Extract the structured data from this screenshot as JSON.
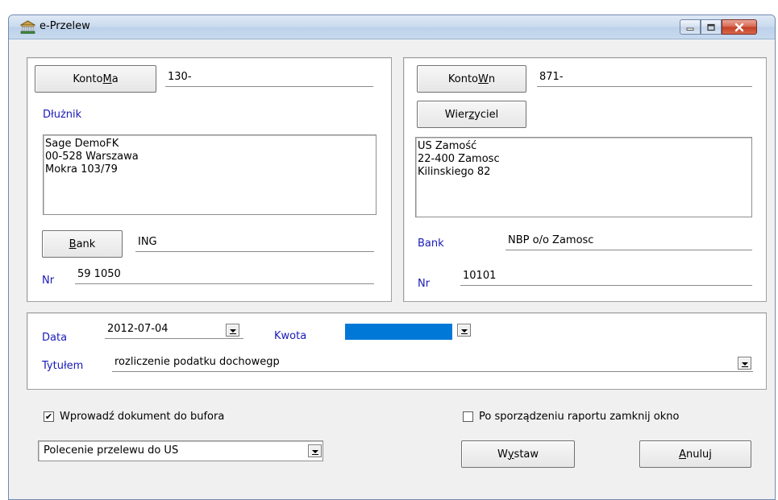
{
  "window": {
    "title": "e-Przelew"
  },
  "left": {
    "konto_button": {
      "prefix": "Konto ",
      "underlined": "M",
      "suffix": "a"
    },
    "konto_value": "130-",
    "dluznik_label": "Dłużnik",
    "address_lines": [
      "Sage DemoFK",
      "00-528 Warszawa",
      "Mokra 103/79"
    ],
    "bank_button": {
      "underlined": "B",
      "suffix": "ank"
    },
    "bank_value": "ING",
    "nr_label": "Nr",
    "nr_value": "59 1050"
  },
  "right": {
    "konto_button": {
      "prefix": "Konto ",
      "underlined": "W",
      "suffix": "n"
    },
    "konto_value": "871-",
    "wierzyciel_button": {
      "prefix": "Wier",
      "underlined": "z",
      "suffix": "yciel"
    },
    "address_lines": [
      "US Zamość",
      "22-400 Zamosc",
      "Kilinskiego 82"
    ],
    "bank_label": "Bank",
    "bank_value": "NBP o/o Zamosc",
    "nr_label": "Nr",
    "nr_value": "10101"
  },
  "middle": {
    "data_label": "Data",
    "data_value": "2012-07-04",
    "kwota_label": "Kwota",
    "kwota_value": "",
    "tytulem_label": "Tytułem",
    "tytulem_value": "rozliczenie podatku dochowegp"
  },
  "bottom": {
    "buffer_checkbox": {
      "label": "Wprowadź dokument do bufora",
      "checked": true
    },
    "close_checkbox": {
      "label": "Po sporządzeniu raportu zamknij okno",
      "checked": false
    },
    "doc_type_select": "Polecenie przelewu do US",
    "wystaw_button": {
      "prefix": "W",
      "underlined": "y",
      "suffix": "staw"
    },
    "anuluj_button": {
      "prefix": "",
      "underlined": "A",
      "suffix": "nuluj"
    }
  },
  "colors": {
    "label_blue": "#1a1ab8",
    "kwota_highlight": "#0078d7"
  },
  "icons": [
    "bank-app-icon",
    "minimize-icon",
    "maximize-icon",
    "close-icon",
    "dropdown-arrow-icon",
    "checkmark-icon"
  ]
}
